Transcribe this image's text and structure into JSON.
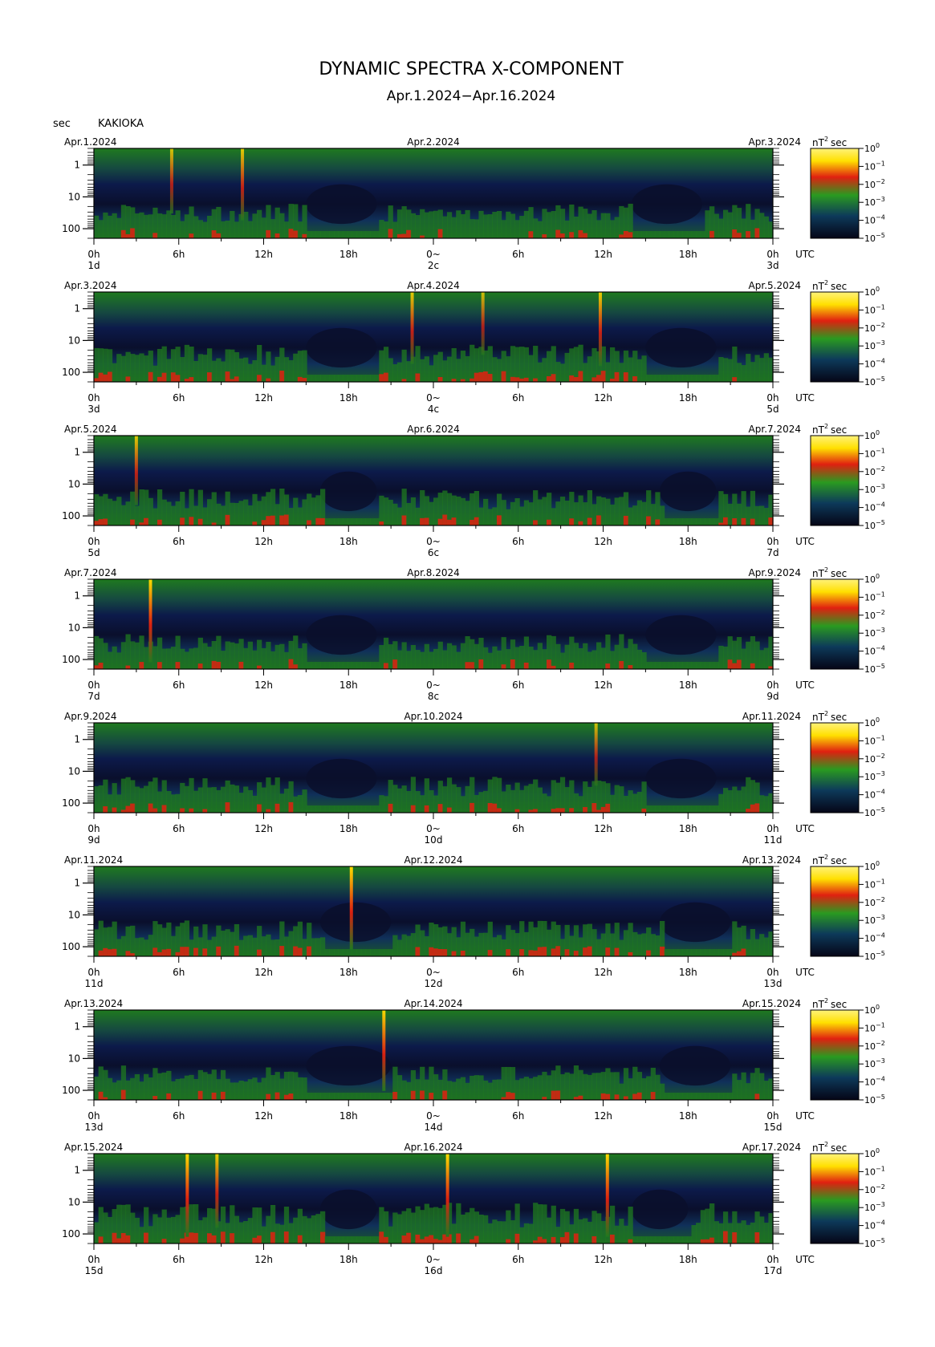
{
  "title": "DYNAMIC SPECTRA X-COMPONENT",
  "subtitle": "Apr.1.2024−Apr.16.2024",
  "y_unit_label": "sec",
  "station": "KAKIOKA",
  "colorbar_unit": "nT",
  "colorbar_unit_exp": "2",
  "colorbar_unit_suffix": "sec",
  "colorbar_ticks": [
    {
      "base": "10",
      "exp": "0"
    },
    {
      "base": "10",
      "exp": "−1"
    },
    {
      "base": "10",
      "exp": "−2"
    },
    {
      "base": "10",
      "exp": "−3"
    },
    {
      "base": "10",
      "exp": "−4"
    },
    {
      "base": "10",
      "exp": "−5"
    }
  ],
  "colors": {
    "background": "#0a0f2c",
    "low": "#0c1a4a",
    "mid": "#1f7a1f",
    "high": "#e02010",
    "peak": "#ffe000"
  },
  "x_time_ticks": [
    "0h",
    "6h",
    "12h",
    "18h",
    "0h",
    "6h",
    "12h",
    "18h",
    "0h"
  ],
  "x_axis_unit": "UTC",
  "y_ticks": [
    "1",
    "10",
    "100"
  ],
  "chart_data": {
    "type": "heatmap",
    "x_axis": "time (UTC)",
    "y_axis": "period (sec), log scale",
    "y_range": [
      0.3,
      200
    ],
    "color_scale": "log",
    "color_range": [
      1e-05,
      1
    ],
    "panels": [
      {
        "left_date": "Apr.1.2024",
        "mid_date": "Apr.2.2024",
        "right_date": "Apr.3.2024",
        "day_labels": [
          "1d",
          "2c",
          "3d"
        ],
        "zero_label": "0~",
        "spikes": [
          {
            "hour": 5.5,
            "level": 0.55
          },
          {
            "hour": 10.5,
            "level": 0.7
          }
        ],
        "quiet_windows": [
          [
            15,
            20
          ],
          [
            38,
            43
          ]
        ],
        "activity": 0.5
      },
      {
        "left_date": "Apr.3.2024",
        "mid_date": "Apr.4.2024",
        "right_date": "Apr.5.2024",
        "day_labels": [
          "3d",
          "4c",
          "5d"
        ],
        "zero_label": "0~",
        "spikes": [
          {
            "hour": 22.5,
            "level": 0.7
          },
          {
            "hour": 27.5,
            "level": 0.5
          },
          {
            "hour": 35.8,
            "level": 0.75
          }
        ],
        "quiet_windows": [
          [
            15,
            20
          ],
          [
            39,
            44
          ]
        ],
        "activity": 0.6
      },
      {
        "left_date": "Apr.5.2024",
        "mid_date": "Apr.6.2024",
        "right_date": "Apr.7.2024",
        "day_labels": [
          "5d",
          "6c",
          "7d"
        ],
        "zero_label": "0~",
        "spikes": [
          {
            "hour": 3.0,
            "level": 0.65
          }
        ],
        "quiet_windows": [
          [
            16,
            20
          ],
          [
            40,
            44
          ]
        ],
        "activity": 0.55
      },
      {
        "left_date": "Apr.7.2024",
        "mid_date": "Apr.8.2024",
        "right_date": "Apr.9.2024",
        "day_labels": [
          "7d",
          "8c",
          "9d"
        ],
        "zero_label": "0~",
        "spikes": [
          {
            "hour": 4.0,
            "level": 0.95
          }
        ],
        "quiet_windows": [
          [
            15,
            20
          ],
          [
            39,
            44
          ]
        ],
        "activity": 0.45
      },
      {
        "left_date": "Apr.9.2024",
        "mid_date": "Apr.10.2024",
        "right_date": "Apr.11.2024",
        "day_labels": [
          "9d",
          "10d",
          "11d"
        ],
        "zero_label": "0~",
        "spikes": [
          {
            "hour": 35.5,
            "level": 0.5
          }
        ],
        "quiet_windows": [
          [
            15,
            20
          ],
          [
            39,
            44
          ]
        ],
        "activity": 0.5
      },
      {
        "left_date": "Apr.11.2024",
        "mid_date": "Apr.12.2024",
        "right_date": "Apr.13.2024",
        "day_labels": [
          "11d",
          "12d",
          "13d"
        ],
        "zero_label": "0~",
        "spikes": [
          {
            "hour": 18.2,
            "level": 0.95
          }
        ],
        "quiet_windows": [
          [
            16,
            21
          ],
          [
            40,
            45
          ]
        ],
        "activity": 0.5
      },
      {
        "left_date": "Apr.13.2024",
        "mid_date": "Apr.14.2024",
        "right_date": "Apr.15.2024",
        "day_labels": [
          "13d",
          "14d",
          "15d"
        ],
        "zero_label": "0~",
        "spikes": [
          {
            "hour": 20.5,
            "level": 0.9
          }
        ],
        "quiet_windows": [
          [
            15,
            21
          ],
          [
            40,
            45
          ]
        ],
        "activity": 0.45
      },
      {
        "left_date": "Apr.15.2024",
        "mid_date": "Apr.16.2024",
        "right_date": "Apr.17.2024",
        "day_labels": [
          "15d",
          "16d",
          "17d"
        ],
        "zero_label": "0~",
        "spikes": [
          {
            "hour": 6.6,
            "level": 0.95
          },
          {
            "hour": 8.7,
            "level": 0.75
          },
          {
            "hour": 25.0,
            "level": 0.95
          },
          {
            "hour": 36.3,
            "level": 0.95
          }
        ],
        "quiet_windows": [
          [
            16,
            20
          ],
          [
            38,
            42
          ]
        ],
        "activity": 0.75
      }
    ]
  }
}
